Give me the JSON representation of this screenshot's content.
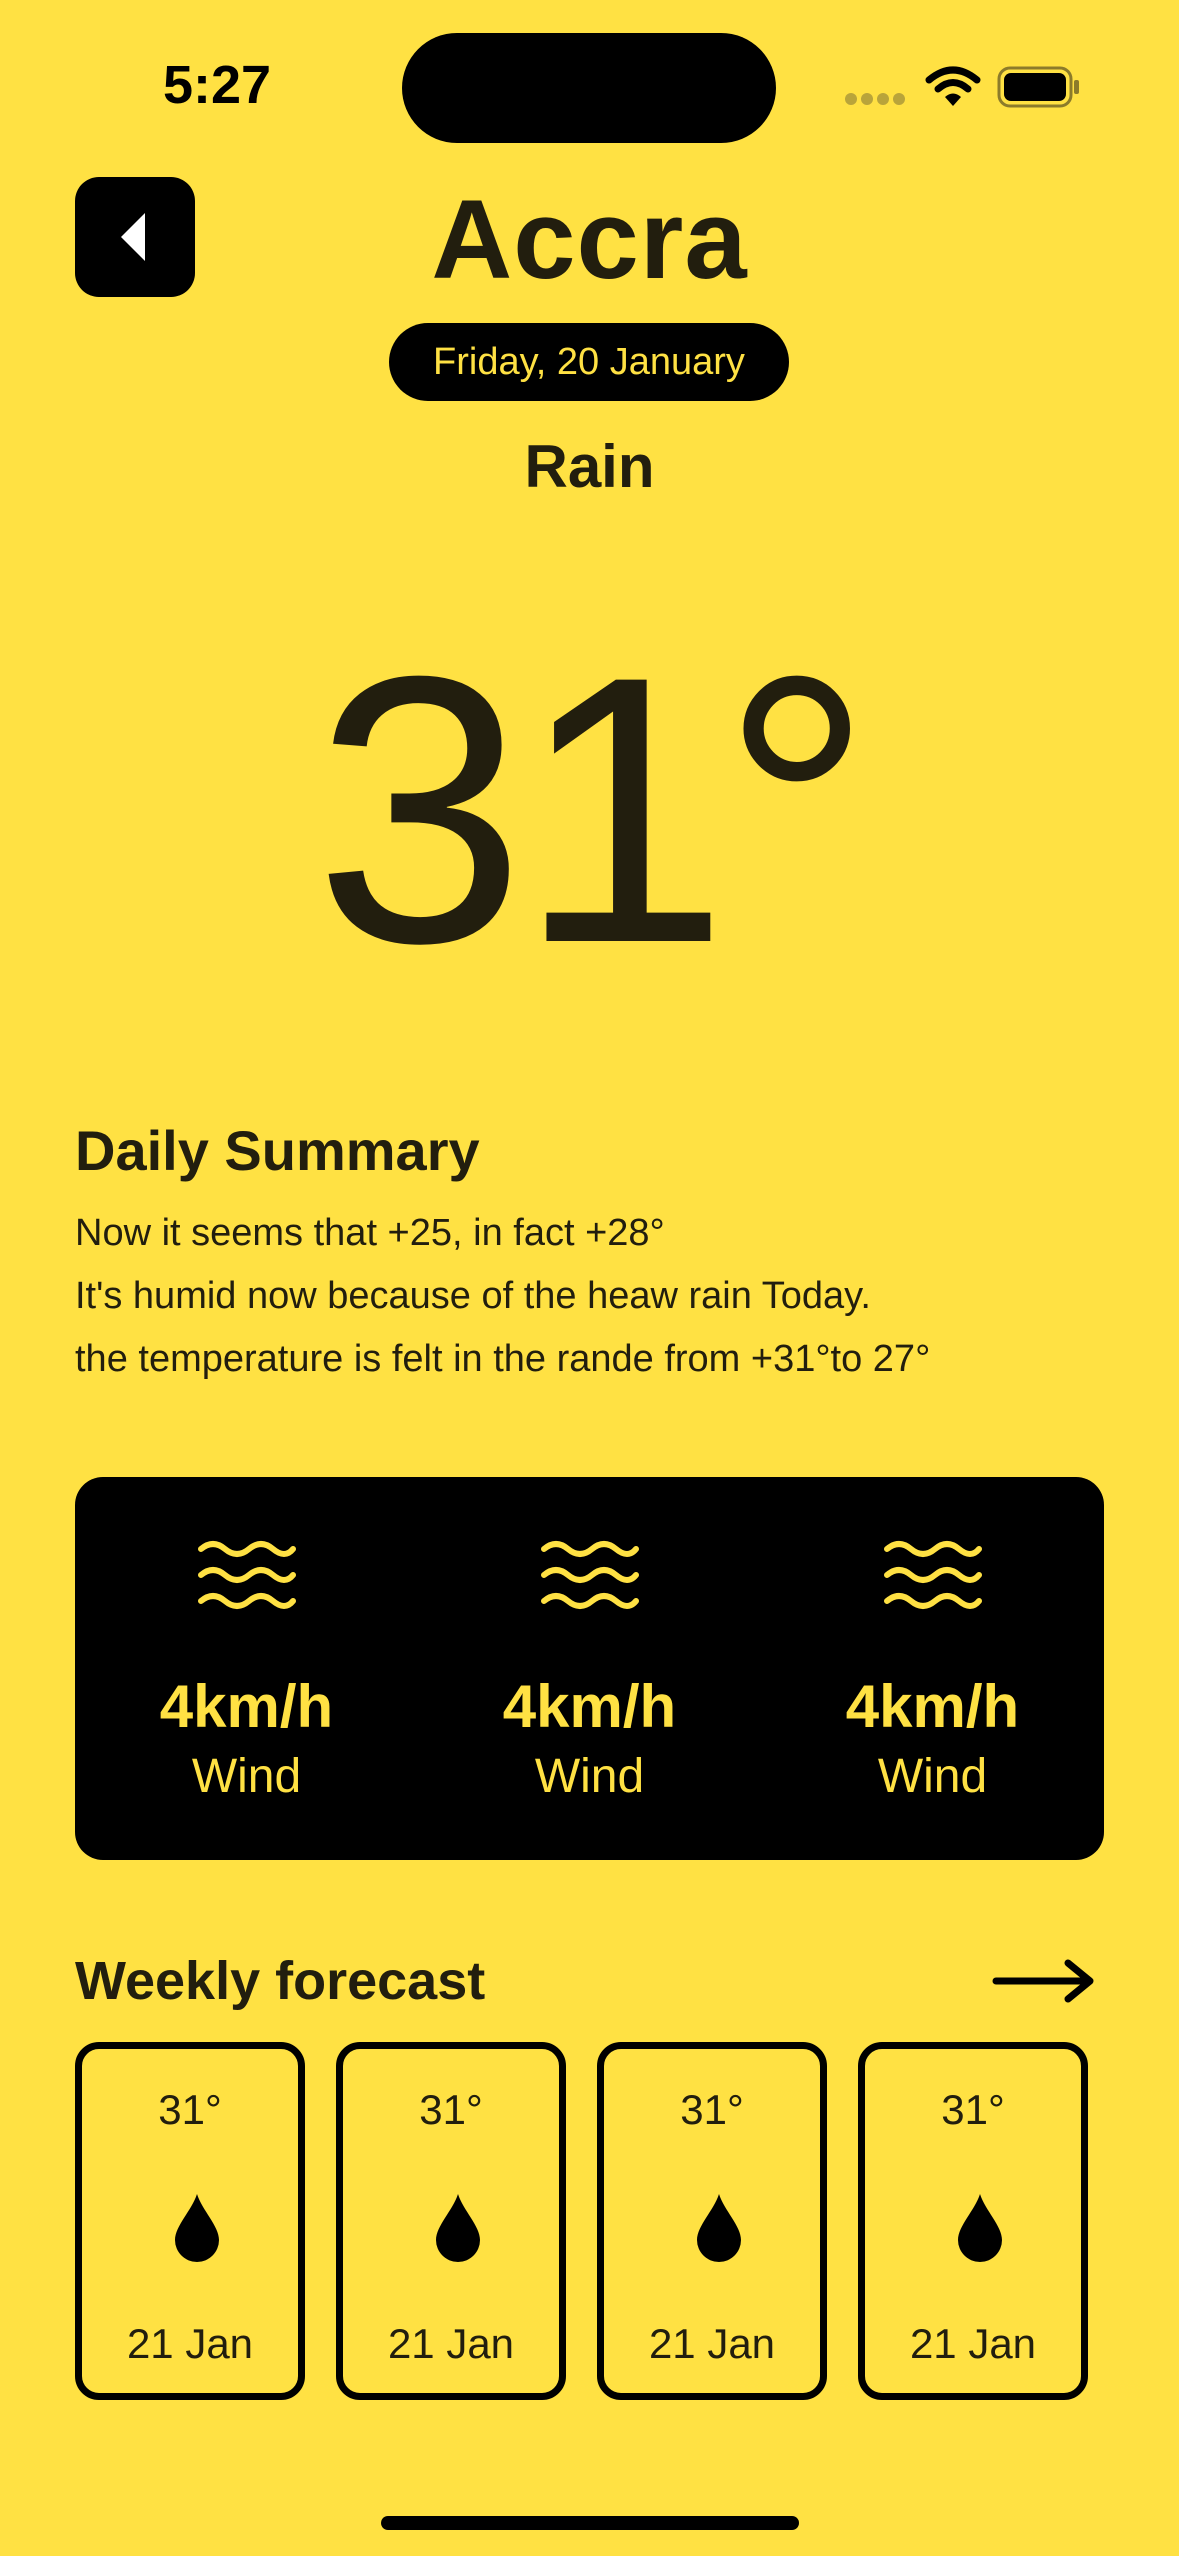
{
  "status_bar": {
    "time": "5:27"
  },
  "header": {
    "back_icon": "back-arrow-icon",
    "city": "Accra",
    "date": "Friday, 20 January",
    "condition": "Rain"
  },
  "current": {
    "temperature": "31°"
  },
  "summary": {
    "title": "Daily Summary",
    "lines": [
      "Now it seems that +25, in fact +28°",
      "It's humid now because of the heaw rain Today.",
      "the temperature is felt in the rande from +31°to 27°"
    ]
  },
  "wind": {
    "items": [
      {
        "value": "4km/h",
        "label": "Wind",
        "icon": "wind-waves-icon"
      },
      {
        "value": "4km/h",
        "label": "Wind",
        "icon": "wind-waves-icon"
      },
      {
        "value": "4km/h",
        "label": "Wind",
        "icon": "wind-waves-icon"
      }
    ]
  },
  "weekly": {
    "title": "Weekly forecast",
    "arrow_icon": "arrow-right-icon",
    "days": [
      {
        "temp": "31°",
        "date": "21 Jan",
        "icon": "raindrop-icon"
      },
      {
        "temp": "31°",
        "date": "21 Jan",
        "icon": "raindrop-icon"
      },
      {
        "temp": "31°",
        "date": "21 Jan",
        "icon": "raindrop-icon"
      },
      {
        "temp": "31°",
        "date": "21 Jan",
        "icon": "raindrop-icon"
      }
    ]
  },
  "colors": {
    "background": "#FFE143",
    "ink": "#221E0E",
    "card": "#000000",
    "accent_on_dark": "#FFE143"
  }
}
